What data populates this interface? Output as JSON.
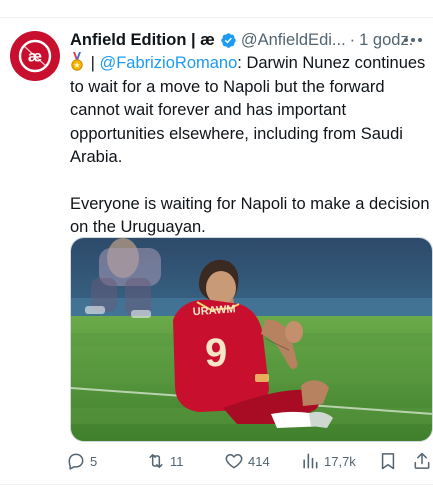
{
  "author": {
    "name": "Anfield Edition | æ",
    "handle": "@AnfieldEdi...",
    "separator": "·",
    "time": "1 godz.",
    "avatar_letters": "æ"
  },
  "tweet": {
    "mention": "@FabrizioRomano",
    "line_prefix": " | ",
    "text_after_mention": ": Darwin Nunez continues to wait for a move to Napoli but the forward cannot wait forever and has important opportunities elsewhere, including from Saudi Arabia.",
    "paragraph2": "Everyone is waiting for Napoli to make a decision on the Uruguayan."
  },
  "media": {
    "shirt_name": "URAWM",
    "shirt_number": "9"
  },
  "actions": {
    "replies": "5",
    "retweets": "11",
    "likes": "414",
    "views": "17,7k"
  },
  "colors": {
    "brand": "#c8102e",
    "link": "#1d9bf0",
    "secondary_text": "#536471",
    "verified": "#1d9bf0",
    "pitch": "#4f9a3a"
  },
  "icons": {
    "reply": "speech-bubble-icon",
    "retweet": "retweet-icon",
    "like": "heart-icon",
    "views": "bar-chart-icon",
    "bookmark": "bookmark-icon",
    "share": "share-icon",
    "more": "more-dots-icon",
    "verified": "verified-badge-icon"
  }
}
